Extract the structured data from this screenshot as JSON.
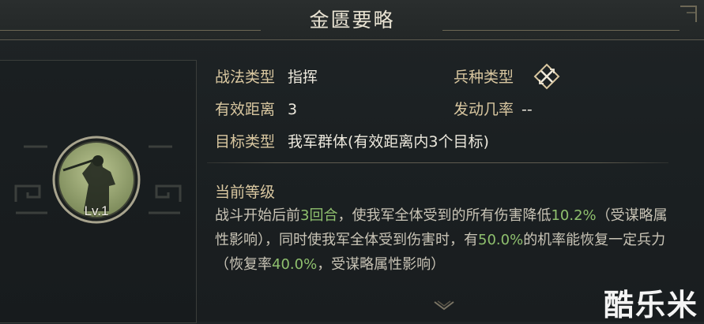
{
  "title": "金匮要略",
  "level": "Lv.1",
  "info": {
    "tactic_type_label": "战法类型",
    "tactic_type_value": "指挥",
    "troop_type_label": "兵种类型",
    "range_label": "有效距离",
    "range_value": "3",
    "trigger_rate_label": "发动几率",
    "trigger_rate_value": "--",
    "target_label": "目标类型",
    "target_value": "我军群体(有效距离内3个目标)"
  },
  "current_level": {
    "heading": "当前等级",
    "desc": {
      "t1": "战斗开始后前",
      "h1": "3回合",
      "t2": "，使我军全体受到的所有伤害降低",
      "h2": "10.2%",
      "t3": "（受谋略属性影响），同时使我军全体受到伤害时，有",
      "h3": "50.0%",
      "t4": "的机率能恢复一定兵力（恢复率",
      "h4": "40.0%",
      "t5": "，受谋略属性影响）"
    }
  },
  "watermark": "酷乐米",
  "colors": {
    "highlight": "#8fc06e",
    "label": "#d9c7a0",
    "background": "#1d2224"
  },
  "icons": {
    "troop_type": "crossed-weapons-icon",
    "scroll": "chevron-down-icon",
    "portrait": "general-portrait"
  }
}
